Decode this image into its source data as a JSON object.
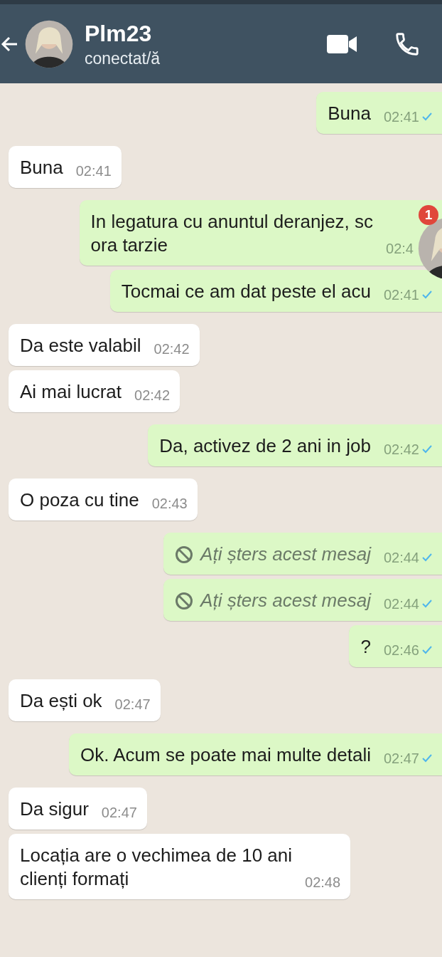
{
  "header": {
    "name": "Plm23",
    "status": "conectat/ă"
  },
  "messages": [
    {
      "kind": "text",
      "outgoing": true,
      "text": "Buna",
      "time": "02:41"
    },
    {
      "kind": "text",
      "outgoing": false,
      "text": "Buna",
      "time": "02:41"
    },
    {
      "kind": "text",
      "outgoing": true,
      "text": "In legatura cu anuntul deranjez, sc\nora tarzie",
      "time": "02:4",
      "tick": false
    },
    {
      "kind": "text",
      "outgoing": true,
      "text": "Tocmai ce am dat peste el acu",
      "time": "02:41"
    },
    {
      "kind": "text",
      "outgoing": false,
      "text": "Da este valabil",
      "time": "02:42"
    },
    {
      "kind": "text",
      "outgoing": false,
      "text": "Ai mai lucrat",
      "time": "02:42"
    },
    {
      "kind": "text",
      "outgoing": true,
      "text": "Da, activez de 2 ani in job",
      "time": "02:42"
    },
    {
      "kind": "text",
      "outgoing": false,
      "text": "O poza cu tine",
      "time": "02:43"
    },
    {
      "kind": "deleted",
      "outgoing": true,
      "text": "Ați șters acest mesaj",
      "time": "02:44"
    },
    {
      "kind": "deleted",
      "outgoing": true,
      "text": "Ați șters acest mesaj",
      "time": "02:44"
    },
    {
      "kind": "text",
      "outgoing": true,
      "text": "?",
      "time": "02:46"
    },
    {
      "kind": "text",
      "outgoing": false,
      "text": "Da ești ok",
      "time": "02:47"
    },
    {
      "kind": "text",
      "outgoing": true,
      "text": "Ok. Acum se poate mai multe detali",
      "time": "02:47"
    },
    {
      "kind": "text",
      "outgoing": false,
      "text": "Da sigur",
      "time": "02:47"
    },
    {
      "kind": "text",
      "outgoing": false,
      "text": "Locația are o vechimea de 10 ani\nclienți formați",
      "time": "02:48"
    }
  ],
  "chat_head": {
    "badge": "1"
  }
}
